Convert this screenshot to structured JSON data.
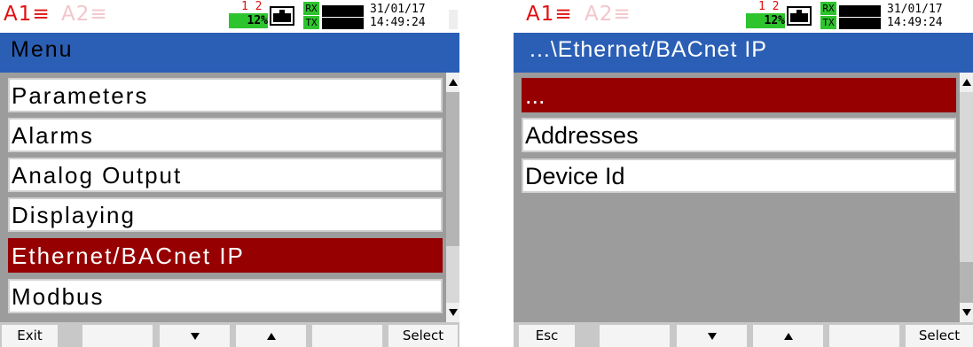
{
  "left": {
    "alarms": {
      "a1": "A1≡",
      "a2": "A2≡"
    },
    "indicator": {
      "channels": "1 2",
      "percent": "12%"
    },
    "comm": {
      "rx": "RX",
      "tx": "TX"
    },
    "date": "31/01/17",
    "time": "14:49:24",
    "title": "Menu",
    "items": [
      {
        "label": "Parameters"
      },
      {
        "label": "Alarms"
      },
      {
        "label": "Analog Output"
      },
      {
        "label": "Displaying"
      },
      {
        "label": "Ethernet/BACnet IP"
      },
      {
        "label": "Modbus"
      }
    ],
    "selected_index": 4,
    "softkeys": {
      "k1": "Exit",
      "k6": "Select"
    }
  },
  "right": {
    "alarms": {
      "a1": "A1≡",
      "a2": "A2≡"
    },
    "indicator": {
      "channels": "1 2",
      "percent": "12%"
    },
    "comm": {
      "rx": "RX",
      "tx": "TX"
    },
    "date": "31/01/17",
    "time": "14:49:24",
    "title": "...\\Ethernet/BACnet IP",
    "items": [
      {
        "label": "..."
      },
      {
        "label": "Addresses"
      },
      {
        "label": "Device Id"
      }
    ],
    "selected_index": 0,
    "softkeys": {
      "k1": "Esc",
      "k6": "Select"
    }
  },
  "colors": {
    "title_bar": "#2b5fb5",
    "selected": "#960000",
    "list_bg": "#9c9c9c",
    "alarm_active": "#e01010",
    "alarm_inactive": "#f2c6cc",
    "indicator_green": "#2ec42e"
  },
  "icons": {
    "scroll_up": "triangle-up-icon",
    "scroll_down": "triangle-down-icon",
    "key_down": "arrow-down-icon",
    "key_up": "arrow-up-icon"
  }
}
